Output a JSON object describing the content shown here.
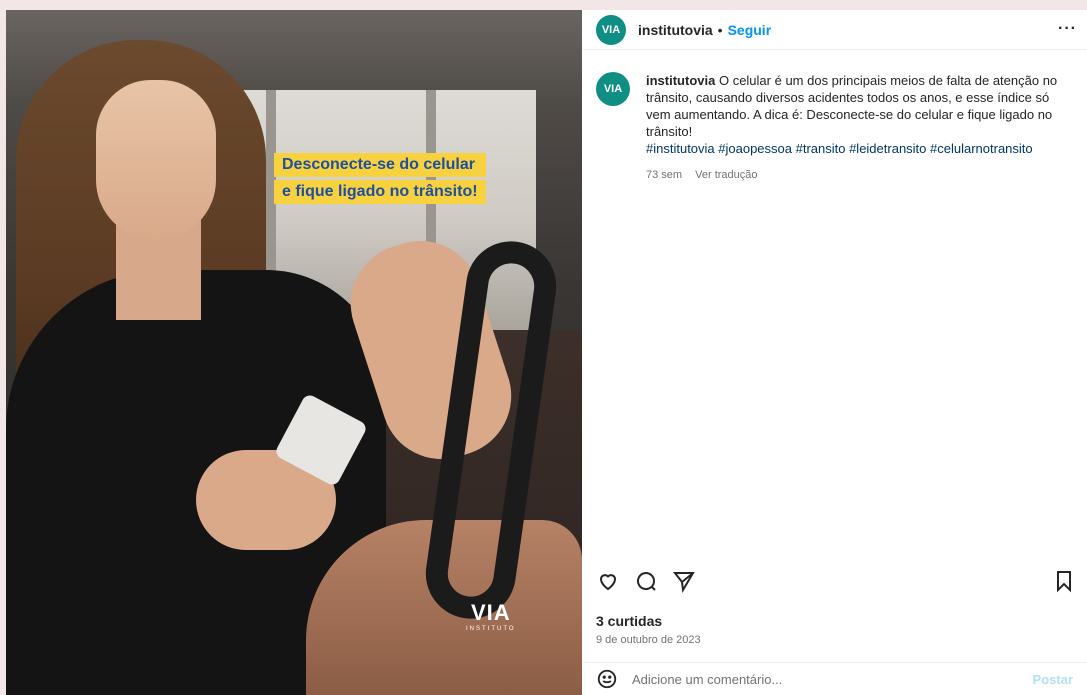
{
  "post_image": {
    "headline_line1": "Desconecte-se do celular",
    "headline_line2": "e fique ligado no trânsito!",
    "logo_mark": "VIA",
    "logo_sub": "INSTITUTO"
  },
  "header": {
    "avatar_text": "VIA",
    "username": "institutovia",
    "separator": "•",
    "follow_label": "Seguir",
    "more_icon": "more-horizontal-icon"
  },
  "caption": {
    "avatar_text": "VIA",
    "username": "institutovia",
    "text": "O celular é um dos principais meios de falta de atenção no trânsito, causando diversos acidentes todos os anos, e esse índice só vem aumentando. A dica é: Desconecte-se do celular e fique ligado no trânsito!",
    "hashtags": "#institutovia #joaopessoa #transito #leidetransito #celularnotransito",
    "age": "73 sem",
    "translate_label": "Ver tradução"
  },
  "actions": {
    "icons": [
      "heart-icon",
      "comment-icon",
      "share-icon",
      "bookmark-icon"
    ]
  },
  "likes": "3 curtidas",
  "date": "9 de outubro de 2023",
  "comment": {
    "placeholder": "Adicione um comentário...",
    "post_label": "Postar"
  },
  "colors": {
    "brand": "#0f8f83",
    "link": "#0095f6",
    "headline_bg": "#f7d23e",
    "headline_fg": "#1e4fa0"
  }
}
